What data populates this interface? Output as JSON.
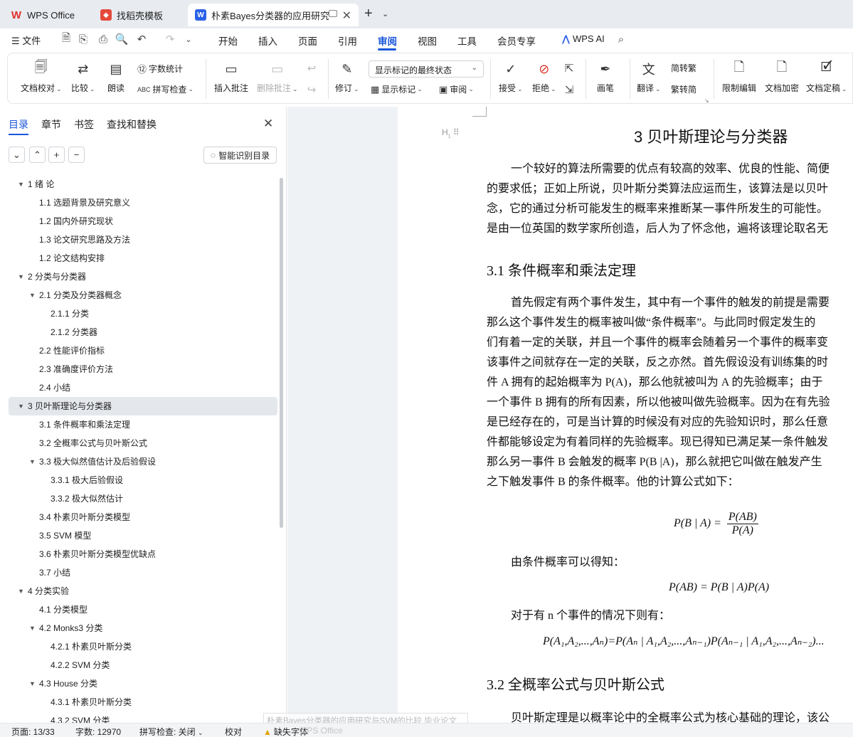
{
  "tabs": [
    {
      "label": "WPS Office"
    },
    {
      "label": "找稻壳模板"
    },
    {
      "label": "朴素Bayes分类器的应用研究与"
    }
  ],
  "menu": {
    "file": "文件",
    "tabs": [
      "开始",
      "插入",
      "页面",
      "引用",
      "审阅",
      "视图",
      "工具",
      "会员专享"
    ],
    "active": "审阅",
    "ai": "WPS AI"
  },
  "ribbon": {
    "doc_check": "文档校对",
    "compare": "比较",
    "read_aloud": "朗读",
    "word_count": "字数统计",
    "spell_check": "拼写检查",
    "insert_comment": "插入批注",
    "delete_comment": "删除批注",
    "revise": "修订",
    "markup_state": "显示标记的最终状态",
    "show_markup": "显示标记",
    "review": "审阅",
    "accept": "接受",
    "reject": "拒绝",
    "pen": "画笔",
    "translate": "翻译",
    "to_traditional": "简转繁",
    "to_simplified": "繁转简",
    "restrict_edit": "限制编辑",
    "encrypt": "文档加密",
    "finalize": "文档定稿"
  },
  "nav": {
    "tabs": [
      "目录",
      "章节",
      "书签",
      "查找和替换"
    ],
    "smart_toc": "智能识别目录",
    "toc": [
      {
        "text": "1  绪  论",
        "level": 1,
        "expand": true
      },
      {
        "text": "1.1  选题背景及研究意义",
        "level": 2
      },
      {
        "text": "1.2  国内外研究现状",
        "level": 2
      },
      {
        "text": "1.3  论文研究思路及方法",
        "level": 2
      },
      {
        "text": "1.2  论文结构安排",
        "level": 2
      },
      {
        "text": "2 分类与分类器",
        "level": 1,
        "expand": true
      },
      {
        "text": "2.1  分类及分类器概念",
        "level": 2,
        "expand": true
      },
      {
        "text": "2.1.1  分类",
        "level": 3
      },
      {
        "text": "2.1.2  分类器",
        "level": 3
      },
      {
        "text": "2.2  性能评价指标",
        "level": 2
      },
      {
        "text": "2.3  准确度评价方法",
        "level": 2
      },
      {
        "text": "2.4  小结",
        "level": 2
      },
      {
        "text": "3 贝叶斯理论与分类器",
        "level": 1,
        "expand": true,
        "selected": true
      },
      {
        "text": "3.1  条件概率和乘法定理",
        "level": 2
      },
      {
        "text": "3.2  全概率公式与贝叶斯公式",
        "level": 2
      },
      {
        "text": "3.3  极大似然值估计及后验假设",
        "level": 2,
        "expand": true
      },
      {
        "text": "3.3.1  极大后验假设",
        "level": 3
      },
      {
        "text": "3.3.2  极大似然估计",
        "level": 3
      },
      {
        "text": "3.4  朴素贝叶斯分类模型",
        "level": 2
      },
      {
        "text": "3.5 SVM 模型",
        "level": 2
      },
      {
        "text": "3.6 朴素贝叶斯分类模型优缺点",
        "level": 2
      },
      {
        "text": "3.7  小结",
        "level": 2
      },
      {
        "text": "4  分类实验",
        "level": 1,
        "expand": true
      },
      {
        "text": "4.1 分类模型",
        "level": 2
      },
      {
        "text": "4.2 Monks3 分类",
        "level": 2,
        "expand": true
      },
      {
        "text": "4.2.1  朴素贝叶斯分类",
        "level": 3
      },
      {
        "text": "4.2.2 SVM 分类",
        "level": 3
      },
      {
        "text": "4.3 House 分类",
        "level": 2,
        "expand": true
      },
      {
        "text": "4.3.1  朴素贝叶斯分类",
        "level": 3
      },
      {
        "text": "4.3.2 SVM 分类",
        "level": 3
      }
    ]
  },
  "doc": {
    "heading_ctl": "H",
    "h1": "3 贝叶斯理论与分类器",
    "p1": [
      "一个较好的算法所需要的优点有较高的效率、优良的性能、简便",
      "的要求低；正如上所说，贝叶斯分类算法应运而生，该算法是以贝叶",
      "念，它的通过分析可能发生的概率来推断某一事件所发生的可能性。",
      "是由一位英国的数学家所创造，后人为了怀念他，遍将该理论取名无"
    ],
    "h2_1": "3.1  条件概率和乘法定理",
    "p2": [
      "首先假定有两个事件发生，其中有一个事件的触发的前提是需要",
      "那么这个事件发生的概率被叫做“条件概率”。与此同时假定发生的",
      "们有着一定的关联，并且一个事件的概率会随着另一个事件的概率变",
      "该事件之间就存在一定的关联，反之亦然。首先假设没有训练集的时",
      "件 A 拥有的起始概率为 P(A)，那么他就被叫为 A 的先验概率；由于",
      "一个事件 B 拥有的所有因素，所以他被叫做先验概率。因为在有先验",
      "是已经存在的，可是当计算的时候没有对应的先验知识时，那么任意",
      "件都能够设定为有着同样的先验概率。现已得知已满足某一条件触发",
      "那么另一事件 B 会触发的概率 P(B |A)，那么就把它叫做在触发产生",
      "之下触发事件 B 的条件概率。他的计算公式如下："
    ],
    "eq1_lhs": "P(B | A) =",
    "eq1_num": "P(AB)",
    "eq1_den": "P(A)",
    "p3": "由条件概率可以得知：",
    "eq2": "P(AB) = P(B | A)P(A)",
    "p4": "对于有 n 个事件的情况下则有：",
    "eq3": "P(A₁,A₂,...,Aₙ)=P(Aₙ | A₁,A₂,...,Aₙ₋₁)P(Aₙ₋₁ | A₁,A₂,...,Aₙ₋₂)...",
    "h2_2": "3.2  全概率公式与贝叶斯公式",
    "p5": "贝叶斯定理是以概率论中的全概率公式为核心基础的理论，该公"
  },
  "float_title": "朴素Bayes分类器的应用研究与SVM的比较 毕业论文",
  "status": {
    "page": "页面: 13/33",
    "words": "字数: 12970",
    "spell": "拼写检查: 关闭",
    "proof": "校对",
    "missing_font": "缺失字体",
    "watermark": "WPS Office"
  }
}
